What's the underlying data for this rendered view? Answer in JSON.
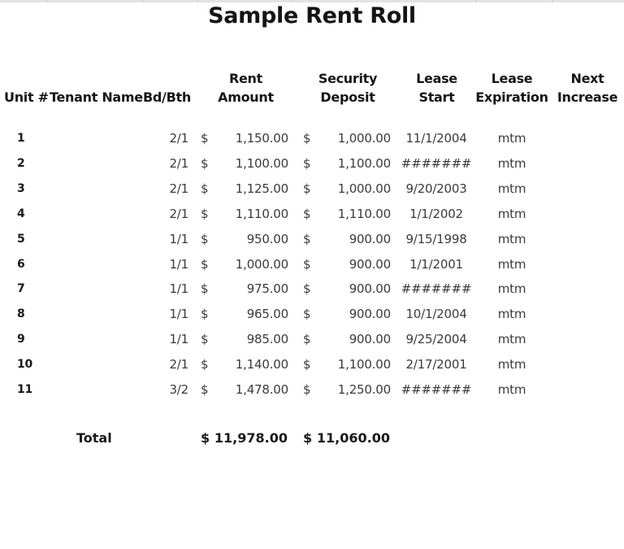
{
  "title": "Sample Rent Roll",
  "headers": {
    "unit": "Unit #",
    "tenant": "Tenant Name",
    "bdbth": "Bd/Bth",
    "rent_l1": "Rent",
    "rent_l2": "Amount",
    "deposit_l1": "Security",
    "deposit_l2": "Deposit",
    "start_l1": "Lease",
    "start_l2": "Start",
    "exp_l1": "Lease",
    "exp_l2": "Expiration",
    "next_l1": "Next",
    "next_l2": "Increase"
  },
  "currency_symbol": "$",
  "rows": [
    {
      "unit": "1",
      "tenant": "",
      "bdbth": "2/1",
      "rent": "1,150.00",
      "deposit": "1,000.00",
      "start": "11/1/2004",
      "expiration": "mtm",
      "next": ""
    },
    {
      "unit": "2",
      "tenant": "",
      "bdbth": "2/1",
      "rent": "1,100.00",
      "deposit": "1,100.00",
      "start": "#######",
      "expiration": "mtm",
      "next": ""
    },
    {
      "unit": "3",
      "tenant": "",
      "bdbth": "2/1",
      "rent": "1,125.00",
      "deposit": "1,000.00",
      "start": "9/20/2003",
      "expiration": "mtm",
      "next": ""
    },
    {
      "unit": "4",
      "tenant": "",
      "bdbth": "2/1",
      "rent": "1,110.00",
      "deposit": "1,110.00",
      "start": "1/1/2002",
      "expiration": "mtm",
      "next": ""
    },
    {
      "unit": "5",
      "tenant": "",
      "bdbth": "1/1",
      "rent": "950.00",
      "deposit": "900.00",
      "start": "9/15/1998",
      "expiration": "mtm",
      "next": ""
    },
    {
      "unit": "6",
      "tenant": "",
      "bdbth": "1/1",
      "rent": "1,000.00",
      "deposit": "900.00",
      "start": "1/1/2001",
      "expiration": "mtm",
      "next": ""
    },
    {
      "unit": "7",
      "tenant": "",
      "bdbth": "1/1",
      "rent": "975.00",
      "deposit": "900.00",
      "start": "#######",
      "expiration": "mtm",
      "next": ""
    },
    {
      "unit": "8",
      "tenant": "",
      "bdbth": "1/1",
      "rent": "965.00",
      "deposit": "900.00",
      "start": "10/1/2004",
      "expiration": "mtm",
      "next": ""
    },
    {
      "unit": "9",
      "tenant": "",
      "bdbth": "1/1",
      "rent": "985.00",
      "deposit": "900.00",
      "start": "9/25/2004",
      "expiration": "mtm",
      "next": ""
    },
    {
      "unit": "10",
      "tenant": "",
      "bdbth": "2/1",
      "rent": "1,140.00",
      "deposit": "1,100.00",
      "start": "2/17/2001",
      "expiration": "mtm",
      "next": ""
    },
    {
      "unit": "11",
      "tenant": "",
      "bdbth": "3/2",
      "rent": "1,478.00",
      "deposit": "1,250.00",
      "start": "#######",
      "expiration": "mtm",
      "next": ""
    }
  ],
  "total": {
    "label": "Total",
    "rent": "11,978.00",
    "deposit": "11,060.00"
  }
}
